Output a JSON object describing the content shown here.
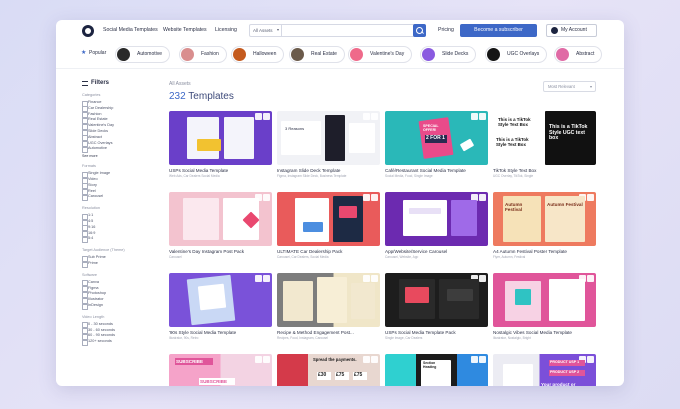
{
  "nav": {
    "links": [
      "Social Media Templates",
      "Website Templates",
      "Licensing"
    ],
    "search_category": "All Assets",
    "search_placeholder": "",
    "pricing": "Pricing",
    "subscribe": "Become a subscriber",
    "account": "My Account"
  },
  "categories": [
    "Popular",
    "Automotive",
    "Fashion",
    "Halloween",
    "Real Estate",
    "Valentine's Day",
    "Slide Decks",
    "UGC Overlays",
    "Abstract"
  ],
  "sidebar": {
    "title": "Filters",
    "sections": [
      {
        "title": "Categories",
        "items": [
          "Finance",
          "Car Dealership",
          "Fashion",
          "Real Estate",
          "Valentine's Day",
          "Slide Decks",
          "Abstract",
          "UGC Overlays",
          "Automotive"
        ],
        "more": "See more"
      },
      {
        "title": "Formats",
        "items": [
          "Single Image",
          "Video",
          "Story",
          "Reel",
          "Carousel"
        ]
      },
      {
        "title": "Resolution",
        "items": [
          "1:1",
          "4:5",
          "9:16",
          "16:9",
          "5:4"
        ]
      },
      {
        "title": "Target Audience (Theme)",
        "items": [
          "Sub Prime",
          "Prime"
        ]
      },
      {
        "title": "Software",
        "items": [
          "Canva",
          "Figma",
          "Photoshop",
          "Illustrator",
          "InDesign"
        ]
      },
      {
        "title": "Video Length",
        "items": [
          "0 - 30 seconds",
          "30 - 60 seconds",
          "60 - 90 seconds",
          "120+ seconds"
        ]
      }
    ]
  },
  "main": {
    "breadcrumb": "All Assets",
    "count": "232",
    "count_label": "Templates",
    "sort": "Most Relevant"
  },
  "cards": [
    {
      "title": "USPs Social Media Template",
      "meta": "Web Ads, Car Dealers Social Media",
      "colors": [
        "#6a3fc9",
        "#7b4fd9"
      ]
    },
    {
      "title": "Instagram Slide Deck Template",
      "meta": "Figma, Instagram Slide Deck, Business Template",
      "colors": [
        "#f1f2f6",
        "#d8dbe6"
      ]
    },
    {
      "title": "Café/Restaurant Social Media Template",
      "meta": "Social Media, Food, Single Image",
      "colors": [
        "#2ab8b8",
        "#35c6c6"
      ]
    },
    {
      "title": "TikTok Style Text Box",
      "meta": "UGC Overlay, TikTok, Single",
      "colors": [
        "#ffffff",
        "#111111"
      ]
    },
    {
      "title": "Valentine's Day Instagram Post Pack",
      "meta": "Carousel",
      "colors": [
        "#f3c3cf",
        "#f7d4dc"
      ]
    },
    {
      "title": "ULTIMATE Car Dealership Pack",
      "meta": "Carousel, Car Dealers, Social Media",
      "colors": [
        "#e95b5b",
        "#f06a6a"
      ]
    },
    {
      "title": "App/Website/Service Carousel",
      "meta": "Carousel, Website, App",
      "colors": [
        "#6c2ab0",
        "#7a35c0"
      ]
    },
    {
      "title": "A4 Autumn Festival Poster Template",
      "meta": "Flyer, Autumn, Festival",
      "colors": [
        "#ee7a5f",
        "#f08a70"
      ]
    },
    {
      "title": "'90s Style Social Media Template",
      "meta": "Illustrator, 90s, Retro",
      "colors": [
        "#7a52d9",
        "#8a62e6"
      ]
    },
    {
      "title": "Recipe & Method Engagement Post...",
      "meta": "Recipes, Food, Instagram, Carousel",
      "colors": [
        "#7d7d7d",
        "#f0e6c8"
      ]
    },
    {
      "title": "USPs Social Media Template Pack",
      "meta": "Single Image, Car Dealers",
      "colors": [
        "#1d1d1d",
        "#2a2a2a"
      ]
    },
    {
      "title": "Nostalgic Vibes Social Media Template",
      "meta": "Illustrator, Nostalgic, Bright",
      "colors": [
        "#e0559a",
        "#ea6aa8"
      ]
    },
    {
      "title": "",
      "meta": "",
      "colors": [
        "#f5a3c9",
        "#f3d3e3"
      ]
    },
    {
      "title": "",
      "meta": "",
      "colors": [
        "#d43a4a",
        "#e8d7d0"
      ]
    },
    {
      "title": "",
      "meta": "",
      "colors": [
        "#1c1c1c",
        "#2fd0d0"
      ]
    },
    {
      "title": "",
      "meta": "",
      "colors": [
        "#ececf3",
        "#7b4fd9"
      ]
    }
  ],
  "card_texts": {
    "card2_line": "3 Reasons",
    "card3_top": "SPECIAL OFFER!",
    "card3_sub": "2 FOR 1",
    "card4_a": "This is a TikTok Style Text Box",
    "card4_b": "This is a TikTok Style Text Box",
    "card4_c": "This is a TikTok Style UGC text box",
    "card7_top": "Autumn Festival",
    "card8_top": "Autumn Festival",
    "card13_tag": "SUBSCRIBE",
    "card13_btn": "SUBSCRIBE",
    "card14_text": "Spread the payments.",
    "card14_p1": "£30",
    "card14_p2": "£75",
    "card14_p3": "£75",
    "card15_text": "Section Heading",
    "card16_a": "PRODUCT USP 1",
    "card16_b": "PRODUCT USP 2",
    "card16_c": "Your product or service is good"
  },
  "accent": "#3d68c7"
}
